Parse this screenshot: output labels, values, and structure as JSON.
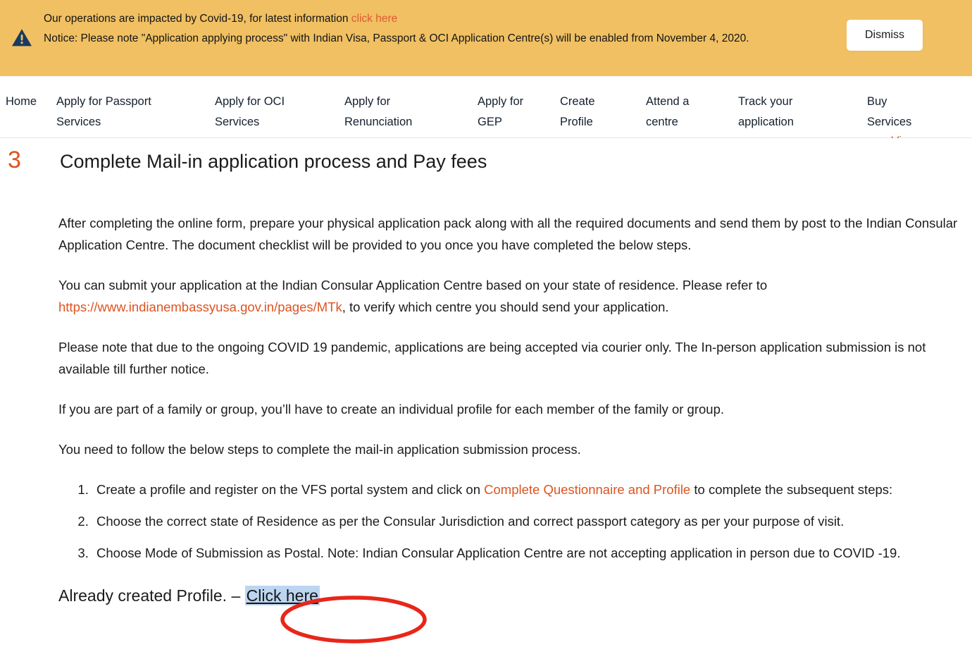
{
  "banner": {
    "icon": "warning-triangle-icon",
    "line1_before": "Our operations are impacted by Covid-19, for latest information ",
    "line1_link": "click here",
    "line2": "Notice: Please note \"Application applying process\" with Indian Visa, Passport & OCI Application Centre(s) will be enabled from November 4, 2020.",
    "dismiss_label": "Dismiss",
    "background_color": "#f0c063",
    "link_color": "#e05a33",
    "icon_color": "#1b3a61"
  },
  "nav": {
    "items": [
      {
        "label": "Home",
        "active": false
      },
      {
        "label": "Apply for Passport\nServices",
        "active": true
      },
      {
        "label": "Apply for OCI\nServices",
        "active": false
      },
      {
        "label": "Apply for\nRenunciation",
        "active": false
      },
      {
        "label": "Apply for\nGEP",
        "active": false
      },
      {
        "label": "Create\nProfile",
        "active": false
      },
      {
        "label": "Attend a\ncentre",
        "active": false
      },
      {
        "label": "Track your\napplication",
        "active": false
      },
      {
        "label": "Buy\nServices",
        "active": false
      }
    ],
    "active_color": "#dd5420"
  },
  "view_more": {
    "label": "View more  ↑"
  },
  "main": {
    "step_number": "3",
    "heading": "Complete Mail-in application process and Pay fees",
    "paragraphs": [
      "After completing the online form, prepare your physical application pack along with all the required documents and send them by post to the Indian Consular Application Centre. The document checklist will be provided to you once you have completed the below steps.",
      "Please note that due to the ongoing COVID 19 pandemic, applications are being accepted via courier only. The In-person application submission is not available till further notice.",
      "If you are part of a family or group, you’ll have to create an individual profile for each member of the family or group.",
      "You need to follow the below steps to complete the mail-in application submission process."
    ],
    "paragraph_with_link": {
      "before": "You can submit your application at the Indian Consular Application Centre based on your state of residence. Please refer to ",
      "link": "https://www.indianembassyusa.gov.in/pages/MTk",
      "after": ", to verify which centre you should send your application."
    },
    "steps": [
      {
        "before": "Create a profile and register on the VFS portal system and click on ",
        "link": "Complete Questionnaire and Profile",
        "after": " to complete the subsequent steps:"
      },
      {
        "before": "Choose the correct state of Residence as per the Consular Jurisdiction and correct passport category as per your purpose of visit.",
        "link": "",
        "after": ""
      },
      {
        "before": "Choose Mode of Submission as Postal. Note: Indian Consular Application Centre are not accepting application in person due to COVID -19.",
        "link": "",
        "after": ""
      }
    ],
    "closing": {
      "text": "Already created Profile. – ",
      "link": "Click here",
      "highlight_color": "#bcd6f2"
    },
    "link_color": "#dd5420",
    "annotation_color": "#e8261a"
  }
}
